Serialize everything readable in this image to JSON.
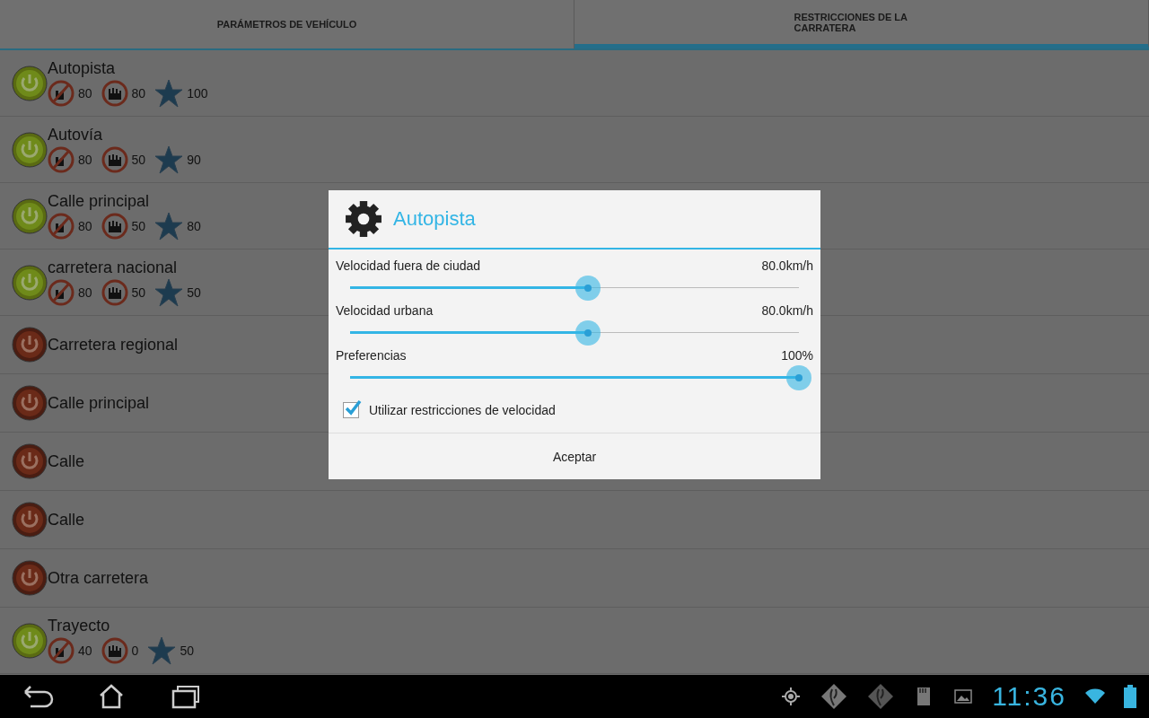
{
  "tabs": [
    {
      "label": "PARÁMETROS DE VEHÍCULO",
      "selected": false
    },
    {
      "label": "RESTRICCIONES DE LA CARRATERA",
      "selected": true
    }
  ],
  "roads": [
    {
      "name": "Autopista",
      "on": true,
      "outside_speed": "80",
      "urban_speed": "80",
      "preference": "100"
    },
    {
      "name": "Autovía",
      "on": true,
      "outside_speed": "80",
      "urban_speed": "50",
      "preference": "90"
    },
    {
      "name": "Calle principal",
      "on": true,
      "outside_speed": "80",
      "urban_speed": "50",
      "preference": "80"
    },
    {
      "name": "carretera nacional",
      "on": true,
      "outside_speed": "80",
      "urban_speed": "50",
      "preference": "50"
    },
    {
      "name": "Carretera regional",
      "on": false
    },
    {
      "name": "Calle principal",
      "on": false
    },
    {
      "name": "Calle",
      "on": false
    },
    {
      "name": "Calle",
      "on": false
    },
    {
      "name": "Otra carretera",
      "on": false
    },
    {
      "name": "Trayecto",
      "on": true,
      "outside_speed": "40",
      "urban_speed": "0",
      "preference": "50"
    }
  ],
  "dialog": {
    "title": "Autopista",
    "sliders": [
      {
        "label": "Velocidad fuera de ciudad",
        "reading": "80.0km/h",
        "level": 0.53
      },
      {
        "label": "Velocidad urbana",
        "reading": "80.0km/h",
        "level": 0.53
      },
      {
        "label": "Preferencias",
        "reading": "100%",
        "level": 1
      }
    ],
    "checkbox": {
      "label": "Utilizar restricciones de velocidad",
      "checked": true
    },
    "button": "Aceptar"
  },
  "status_bar": {
    "time": "11:36"
  }
}
